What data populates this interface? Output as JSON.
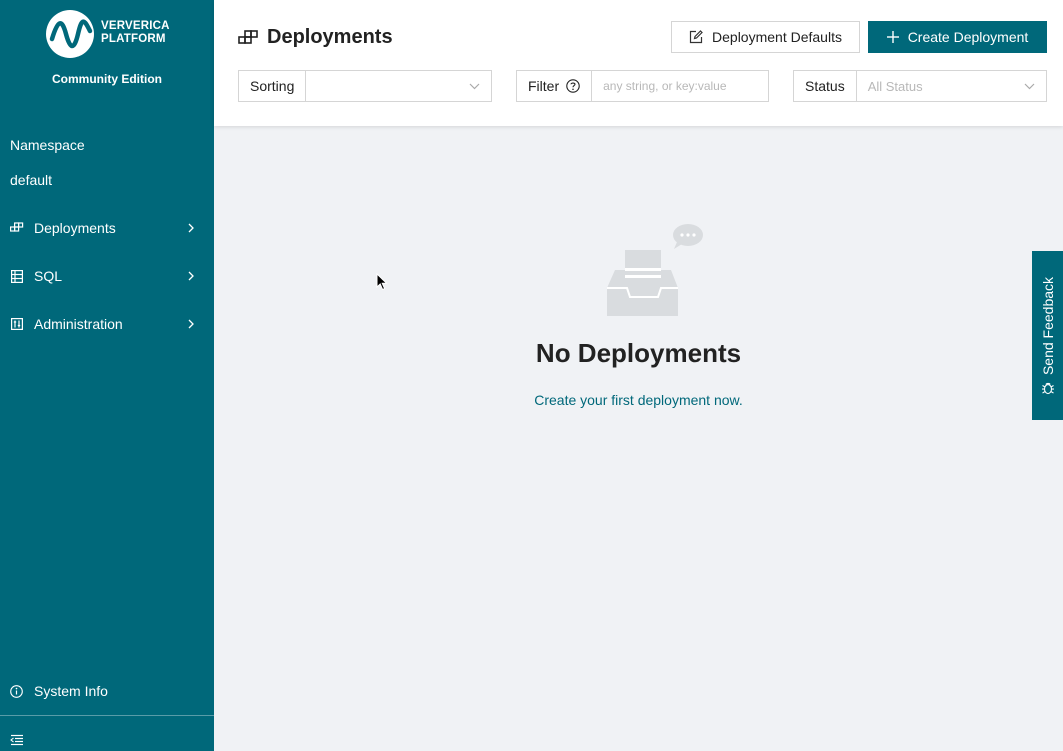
{
  "app": {
    "brand_line1": "VERVERICA",
    "brand_line2": "PLATFORM",
    "edition": "Community Edition"
  },
  "sidebar": {
    "namespace_label": "Namespace",
    "namespace_value": "default",
    "items": [
      {
        "label": "Deployments",
        "icon": "deployments-icon"
      },
      {
        "label": "SQL",
        "icon": "sql-icon"
      },
      {
        "label": "Administration",
        "icon": "administration-icon"
      }
    ],
    "system_info": "System Info"
  },
  "header": {
    "title": "Deployments",
    "defaults_button": "Deployment Defaults",
    "create_button": "Create Deployment"
  },
  "filters": {
    "sorting_label": "Sorting",
    "sorting_value": "",
    "filter_label": "Filter",
    "filter_placeholder": "any string, or key:value",
    "status_label": "Status",
    "status_placeholder": "All Status"
  },
  "empty_state": {
    "title": "No Deployments",
    "link": "Create your first deployment now."
  },
  "feedback": {
    "label": "Send Feedback"
  },
  "colors": {
    "brand": "#00687a",
    "background": "#f0f2f5"
  }
}
